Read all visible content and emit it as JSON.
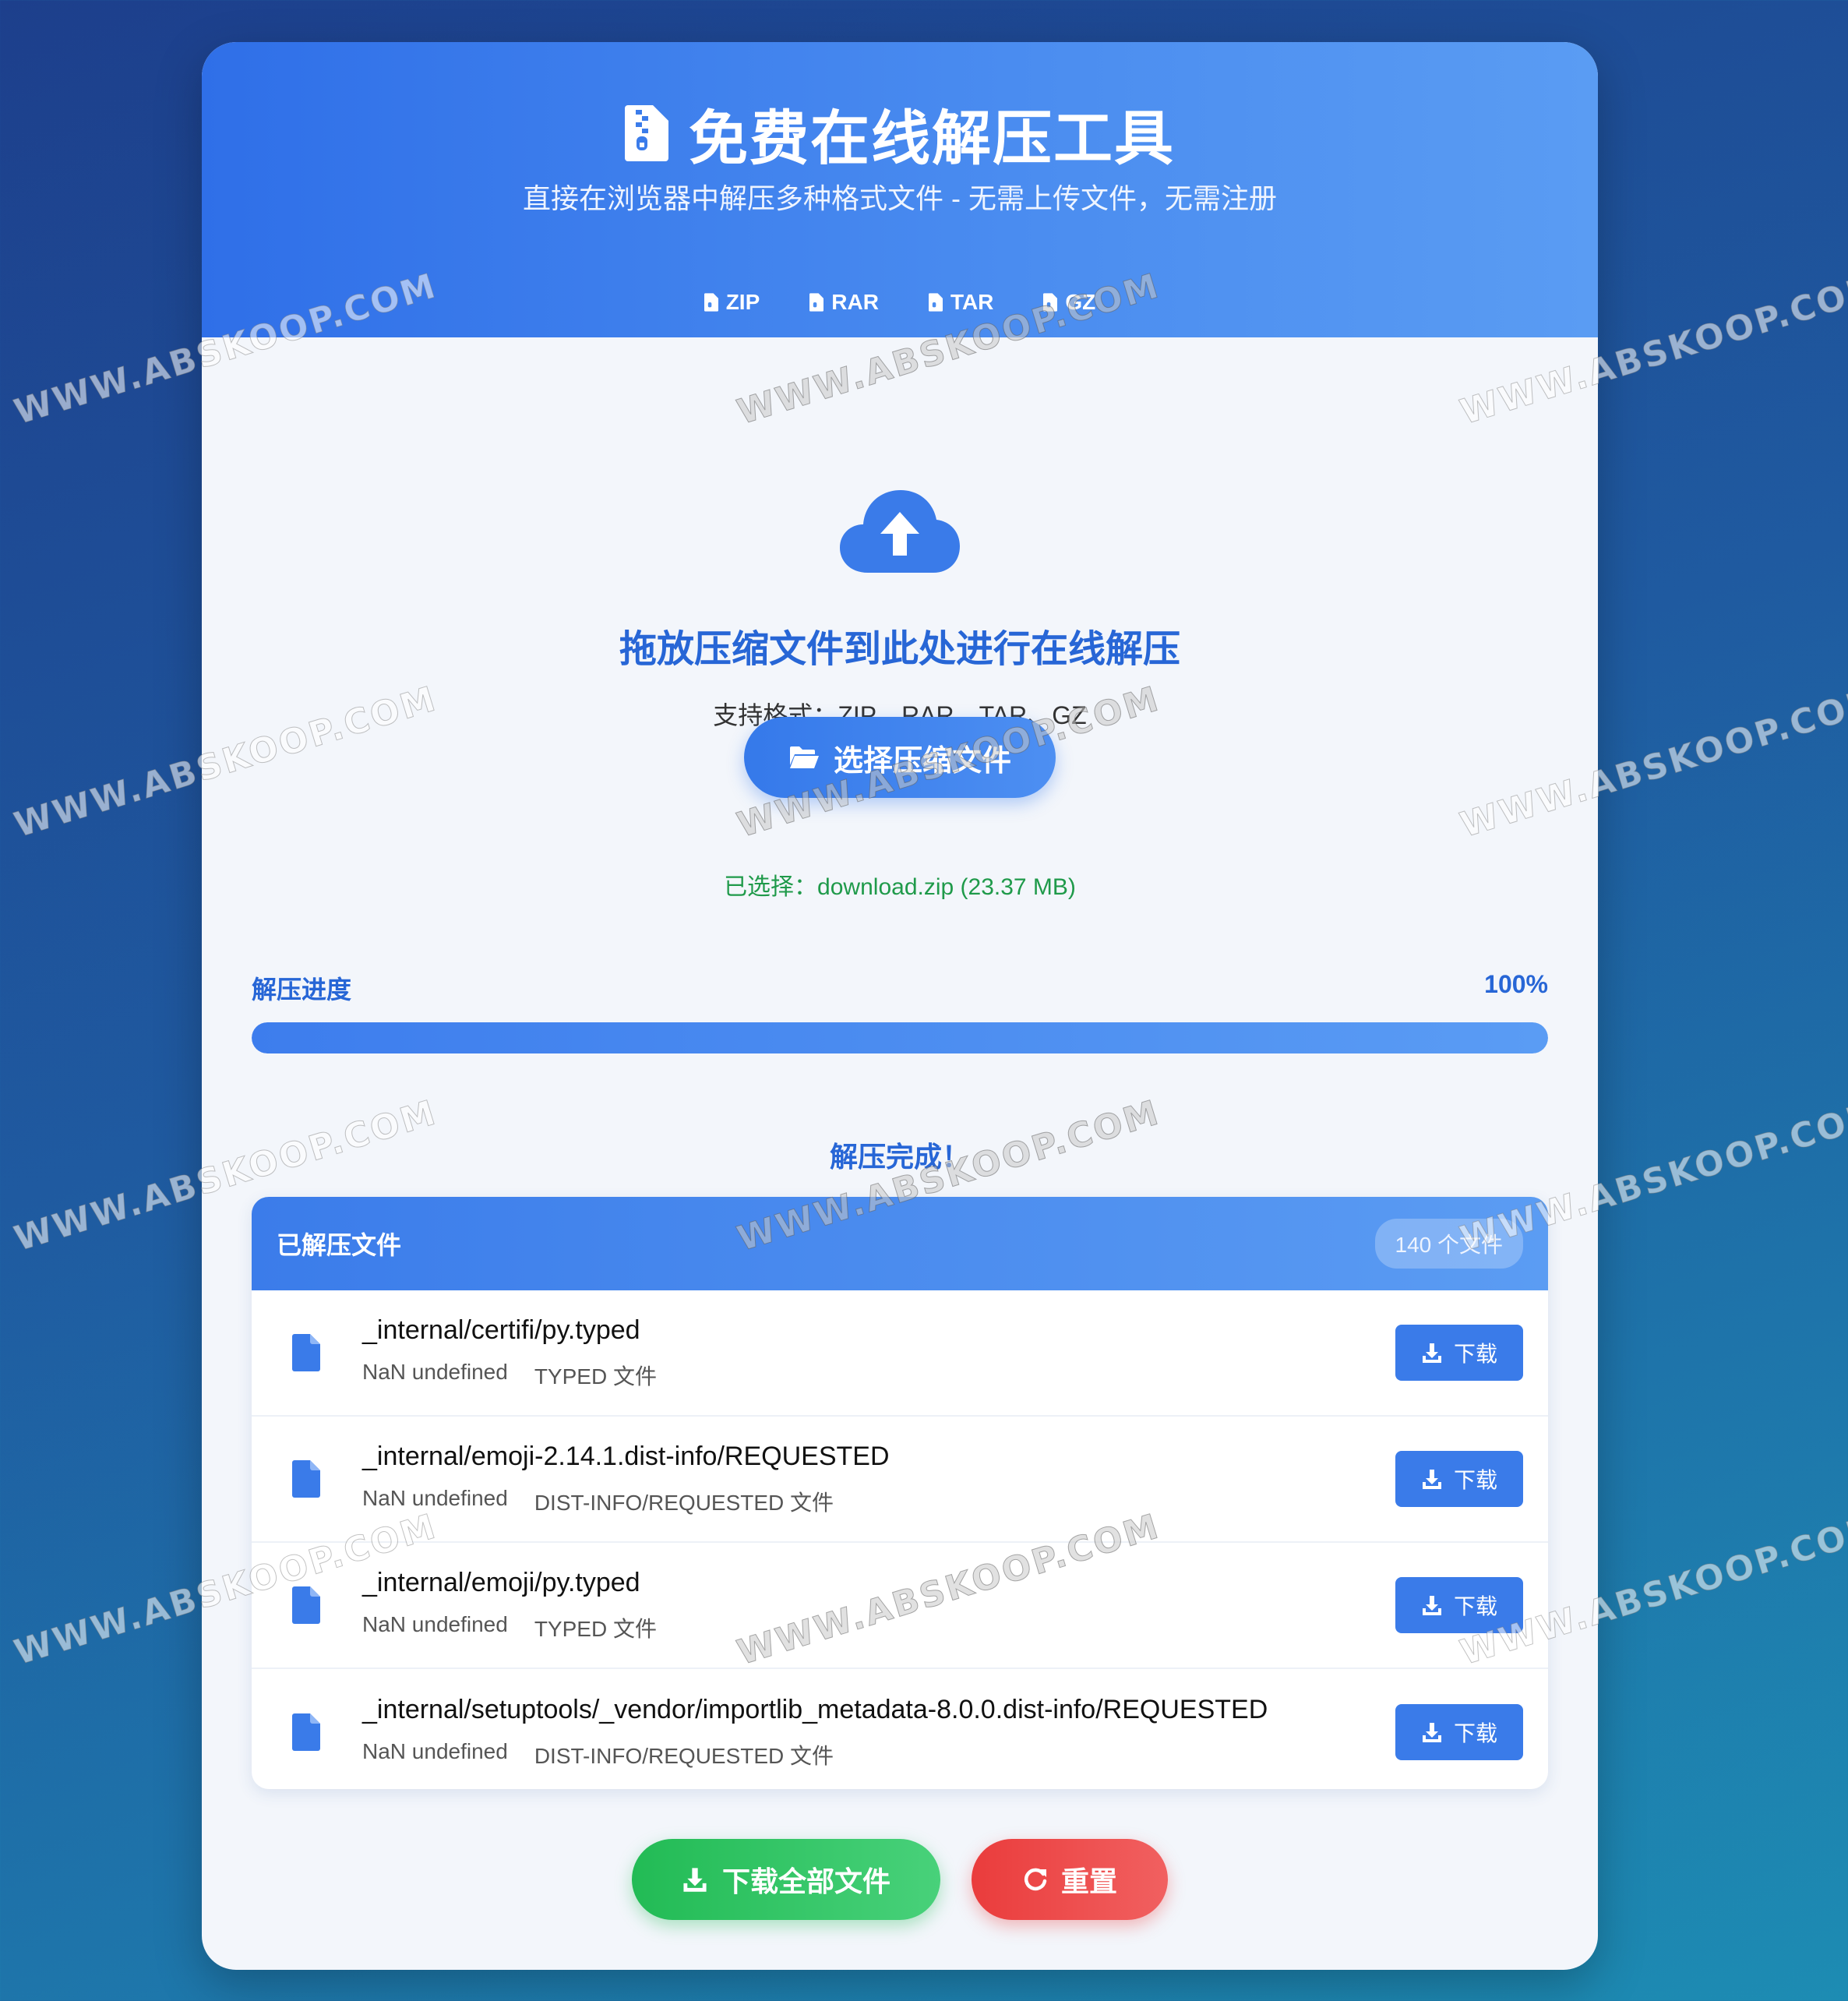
{
  "header": {
    "title": "免费在线解压工具",
    "subtitle": "直接在浏览器中解压多种格式文件 - 无需上传文件，无需注册",
    "formats": [
      "ZIP",
      "RAR",
      "TAR",
      "GZ"
    ]
  },
  "upload": {
    "drop_title": "拖放压缩文件到此处进行在线解压",
    "supported_formats": "支持格式：ZIP、RAR、TAR、GZ",
    "choose_button": "选择压缩文件",
    "selected_file": "已选择：download.zip (23.37 MB)"
  },
  "progress": {
    "label": "解压进度",
    "percent_text": "100%",
    "value": 1.0
  },
  "status": {
    "done_text": "解压完成！"
  },
  "files_panel": {
    "title": "已解压文件",
    "count_badge": "140 个文件",
    "download_label": "下载",
    "items": [
      {
        "name": "_internal/certifi/py.typed",
        "size": "NaN undefined",
        "type": "TYPED 文件"
      },
      {
        "name": "_internal/emoji-2.14.1.dist-info/REQUESTED",
        "size": "NaN undefined",
        "type": "DIST-INFO/REQUESTED 文件"
      },
      {
        "name": "_internal/emoji/py.typed",
        "size": "NaN undefined",
        "type": "TYPED 文件"
      },
      {
        "name": "_internal/setuptools/_vendor/importlib_metadata-8.0.0.dist-info/REQUESTED",
        "size": "NaN undefined",
        "type": "DIST-INFO/REQUESTED 文件"
      }
    ]
  },
  "actions": {
    "download_all": "下载全部文件",
    "reset": "重置"
  },
  "watermark": "WWW.ABSKOOP.COM",
  "colors": {
    "primary": "#3579ea",
    "success": "#22bb55",
    "danger": "#ea3c3c",
    "selected_text": "#1f9a4a"
  }
}
